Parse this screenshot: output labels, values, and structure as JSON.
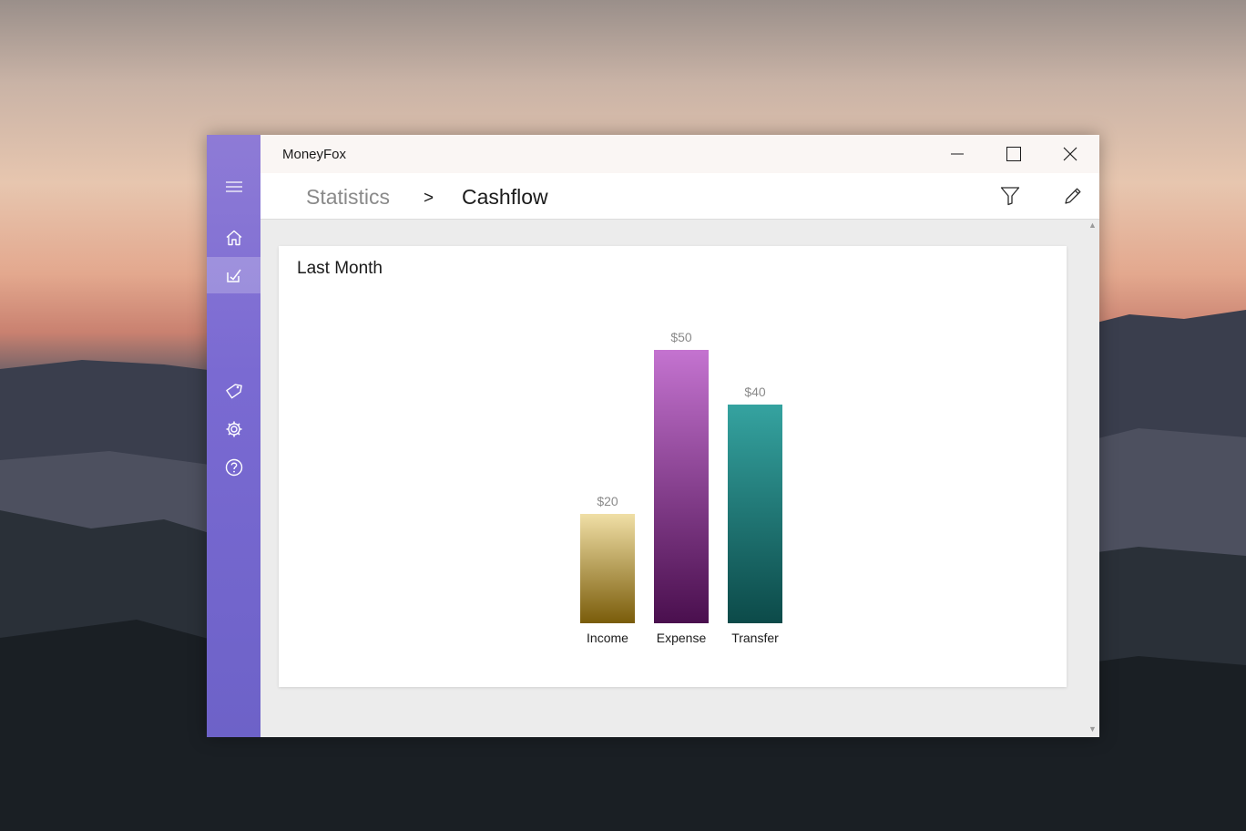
{
  "window": {
    "title": "MoneyFox"
  },
  "nav": {
    "items": [
      {
        "icon": "hamburger-icon"
      },
      {
        "icon": "home-icon"
      },
      {
        "icon": "statistics-icon",
        "active": true
      },
      {
        "icon": "tag-icon"
      },
      {
        "icon": "gear-icon"
      },
      {
        "icon": "help-icon"
      }
    ]
  },
  "header": {
    "breadcrumb_root": "Statistics",
    "breadcrumb_separator": ">",
    "breadcrumb_current": "Cashflow"
  },
  "card": {
    "title": "Last Month"
  },
  "chart_data": {
    "type": "bar",
    "categories": [
      "Income",
      "Expense",
      "Transfer"
    ],
    "values": [
      20,
      50,
      40
    ],
    "value_labels": [
      "$20",
      "$50",
      "$40"
    ],
    "colors": [
      {
        "top": "#f0dfa6",
        "bottom": "#7a5c0a"
      },
      {
        "top": "#c473d0",
        "bottom": "#4a0f4e"
      },
      {
        "top": "#35a3a0",
        "bottom": "#0c4a49"
      }
    ],
    "ylim": [
      0,
      50
    ],
    "grid": false,
    "legend": "none"
  }
}
